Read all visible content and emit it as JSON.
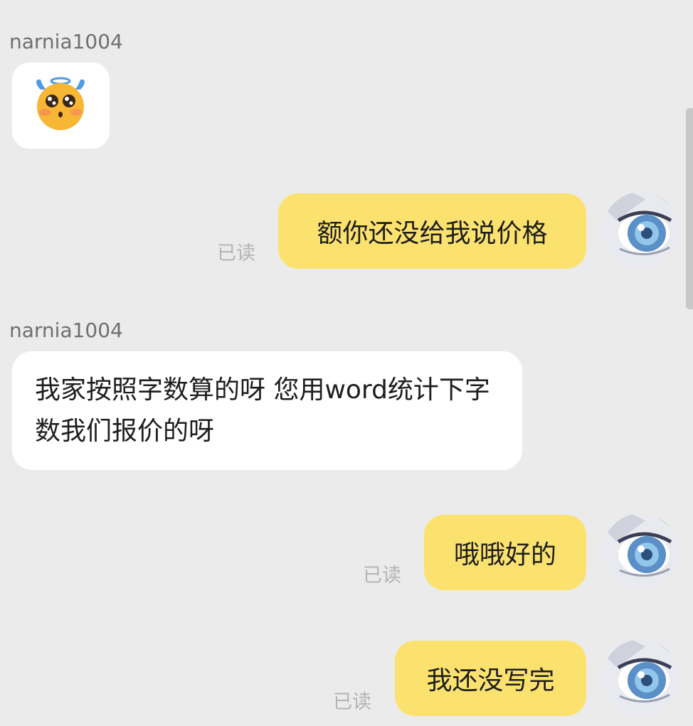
{
  "chat": {
    "sender_name": "narnia1004",
    "sticker_icon": "angel-face-emoji-icon",
    "messages": [
      {
        "text": "额你还没给我说价格",
        "read": "已读"
      },
      {
        "text": "我家按照字数算的呀  您用word统计下字数我们报价的呀"
      },
      {
        "text": "哦哦好的",
        "read": "已读"
      },
      {
        "text": "我还没写完",
        "read": "已读"
      }
    ]
  },
  "colors": {
    "background": "#ebebeb",
    "my_bubble": "#fbe26f",
    "their_bubble": "#ffffff",
    "read_status": "#b4b4b4"
  }
}
